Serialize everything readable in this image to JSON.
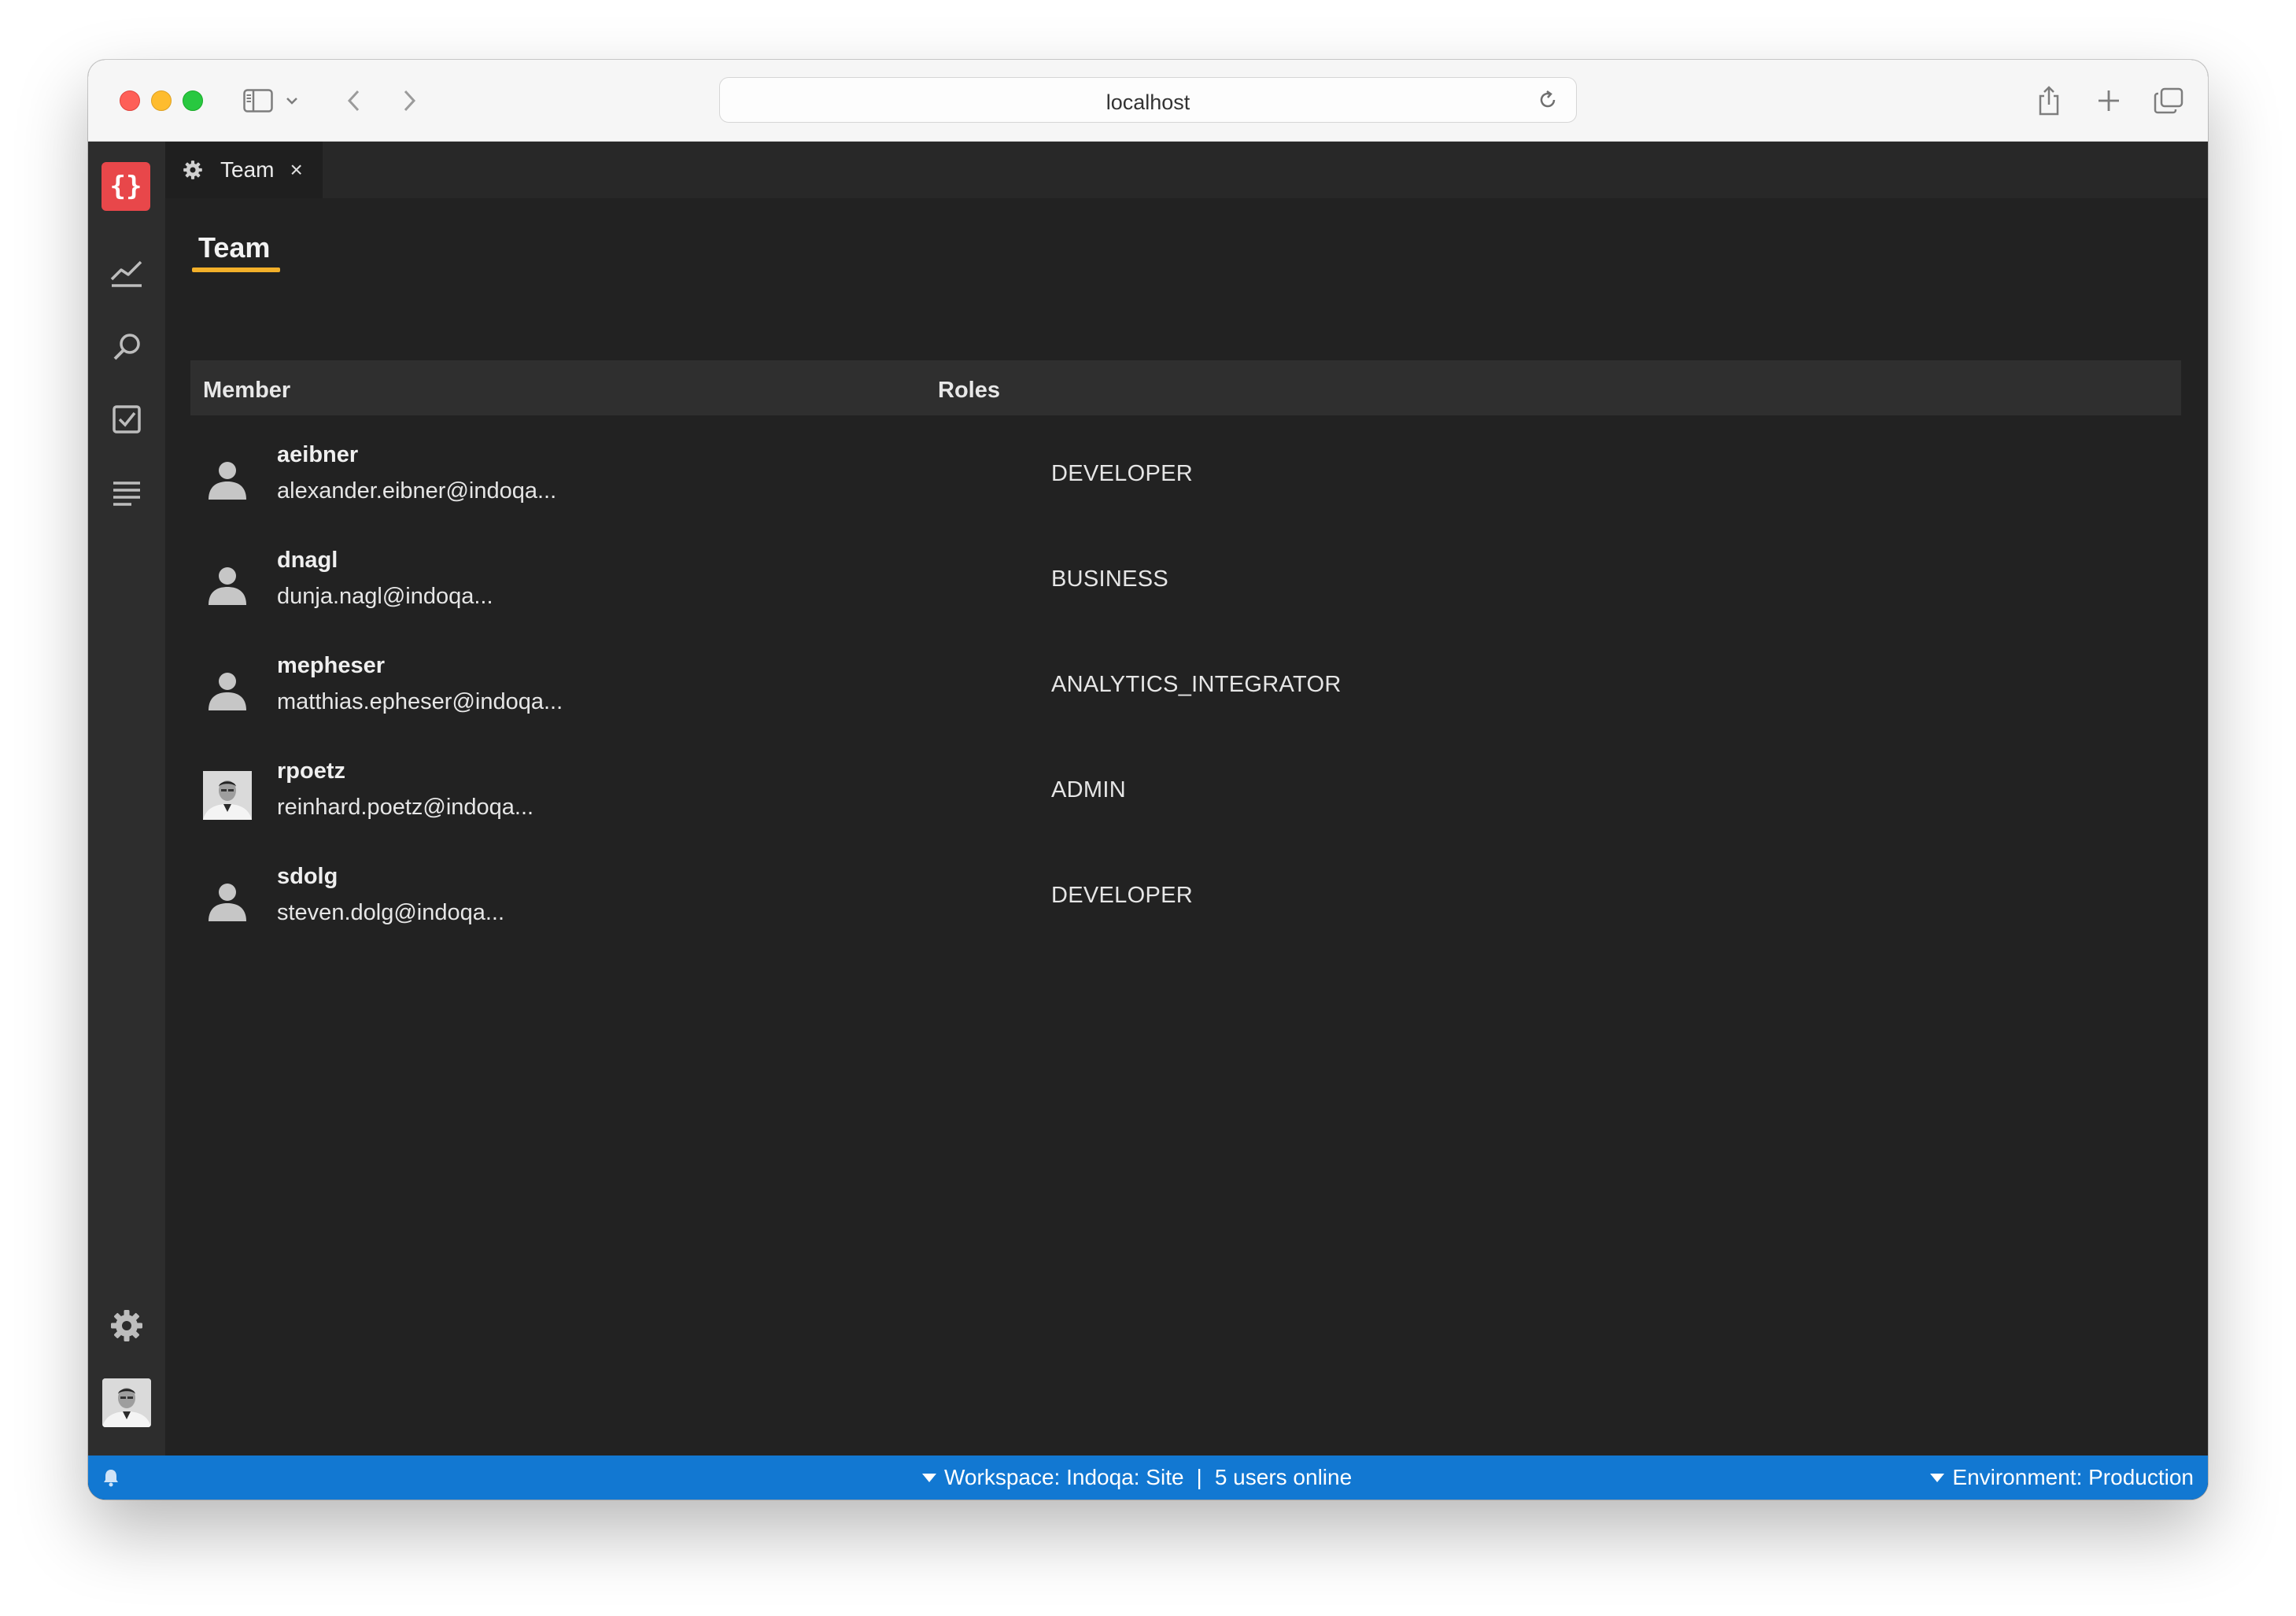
{
  "browser": {
    "url": "localhost"
  },
  "app": {
    "logo_text": "{}",
    "tab": {
      "label": "Team",
      "close": "×"
    },
    "page_title": "Team",
    "columns": {
      "member": "Member",
      "roles": "Roles"
    },
    "members": [
      {
        "username": "aeibner",
        "email": "alexander.eibner@indoqa...",
        "role": "DEVELOPER",
        "avatar": "person-placeholder"
      },
      {
        "username": "dnagl",
        "email": "dunja.nagl@indoqa...",
        "role": "BUSINESS",
        "avatar": "person-placeholder"
      },
      {
        "username": "mepheser",
        "email": "matthias.epheser@indoqa...",
        "role": "ANALYTICS_INTEGRATOR",
        "avatar": "person-placeholder"
      },
      {
        "username": "rpoetz",
        "email": "reinhard.poetz@indoqa...",
        "role": "ADMIN",
        "avatar": "photo"
      },
      {
        "username": "sdolg",
        "email": "steven.dolg@indoqa...",
        "role": "DEVELOPER",
        "avatar": "person-placeholder"
      }
    ],
    "status_bar": {
      "workspace": "Workspace: Indoqa: Site",
      "separator": "|",
      "users_online": "5 users online",
      "environment": "Environment: Production"
    }
  },
  "colors": {
    "accent_underline": "#f2b02a",
    "logo_bg": "#e8474a",
    "status_bar": "#1278d2"
  }
}
